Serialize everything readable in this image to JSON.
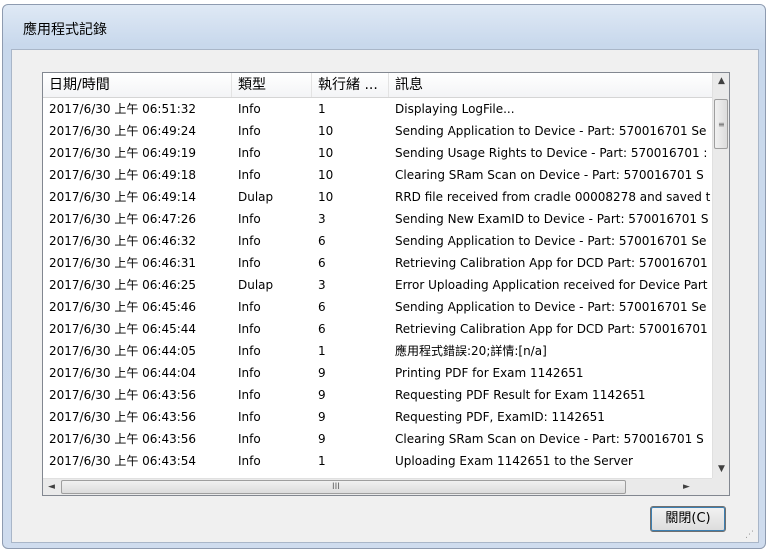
{
  "window": {
    "title": "應用程式記錄"
  },
  "listview": {
    "columns": [
      "日期/時間",
      "類型",
      "執行緒 ...",
      "訊息"
    ],
    "rows": [
      [
        "2017/6/30 上午 06:51:32",
        "Info",
        "1",
        "Displaying LogFile..."
      ],
      [
        "2017/6/30 上午 06:49:24",
        "Info",
        "10",
        "Sending Application to Device - Part: 570016701 Se"
      ],
      [
        "2017/6/30 上午 06:49:19",
        "Info",
        "10",
        "Sending Usage Rights to Device - Part: 570016701 :"
      ],
      [
        "2017/6/30 上午 06:49:18",
        "Info",
        "10",
        "Clearing SRam Scan on Device - Part: 570016701 S"
      ],
      [
        "2017/6/30 上午 06:49:14",
        "Dulap",
        "10",
        "RRD file received from cradle 00008278 and saved t"
      ],
      [
        "2017/6/30 上午 06:47:26",
        "Info",
        "3",
        "Sending New ExamID to Device - Part: 570016701 S"
      ],
      [
        "2017/6/30 上午 06:46:32",
        "Info",
        "6",
        "Sending Application to Device - Part: 570016701 Se"
      ],
      [
        "2017/6/30 上午 06:46:31",
        "Info",
        "6",
        "Retrieving Calibration App for DCD Part: 570016701"
      ],
      [
        "2017/6/30 上午 06:46:25",
        "Dulap",
        "3",
        "Error Uploading Application received for Device Part"
      ],
      [
        "2017/6/30 上午 06:45:46",
        "Info",
        "6",
        "Sending Application to Device - Part: 570016701 Se"
      ],
      [
        "2017/6/30 上午 06:45:44",
        "Info",
        "6",
        "Retrieving Calibration App for DCD Part: 570016701"
      ],
      [
        "2017/6/30 上午 06:44:05",
        "Info",
        "1",
        "應用程式錯誤:20;詳情:[n/a]"
      ],
      [
        "2017/6/30 上午 06:44:04",
        "Info",
        "9",
        "Printing PDF for Exam 1142651"
      ],
      [
        "2017/6/30 上午 06:43:56",
        "Info",
        "9",
        "Requesting PDF Result for Exam 1142651"
      ],
      [
        "2017/6/30 上午 06:43:56",
        "Info",
        "9",
        "Requesting PDF, ExamID: 1142651"
      ],
      [
        "2017/6/30 上午 06:43:56",
        "Info",
        "9",
        "Clearing SRam Scan on Device - Part: 570016701 S"
      ],
      [
        "2017/6/30 上午 06:43:54",
        "Info",
        "1",
        "Uploading Exam 1142651 to the Server"
      ]
    ]
  },
  "buttons": {
    "close": "關閉(C)"
  }
}
